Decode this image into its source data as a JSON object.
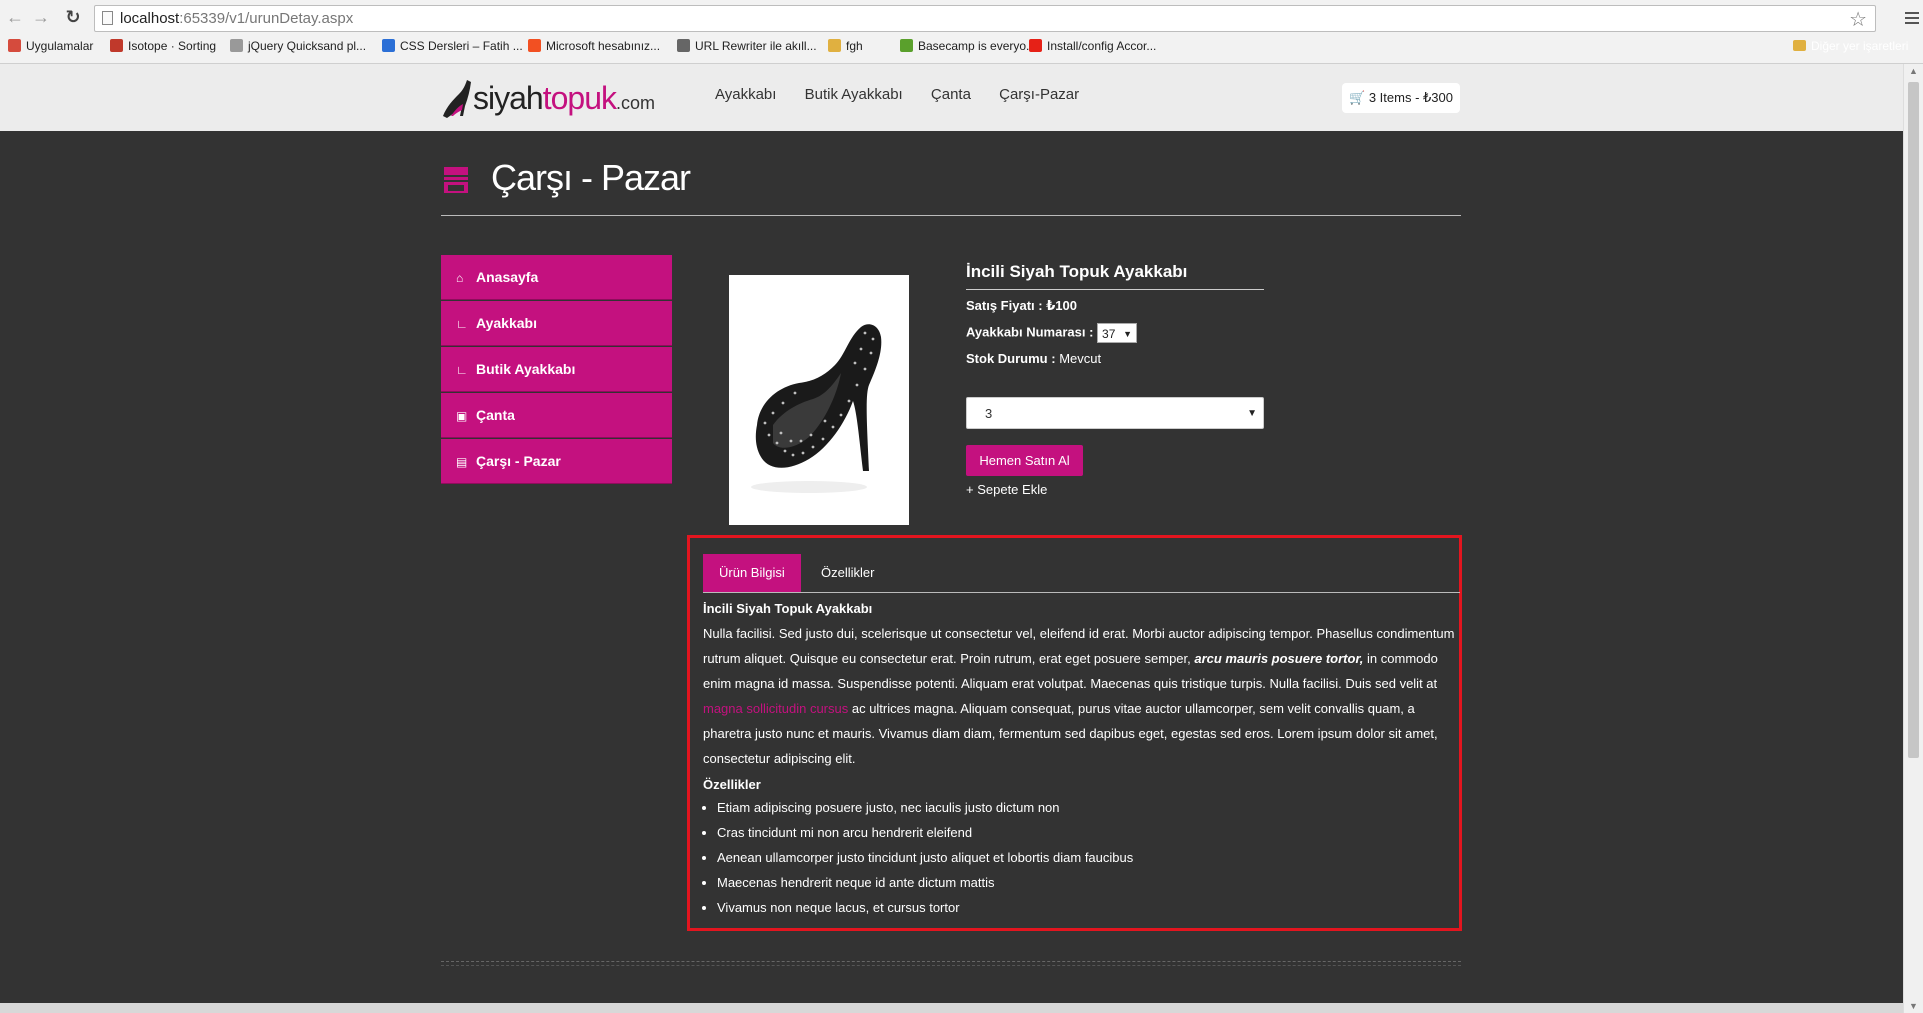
{
  "browser": {
    "url_host": "localhost",
    "url_rest": ":65339/v1/urunDetay.aspx",
    "bookmarks": [
      {
        "label": "Uygulamalar",
        "icon": "apps-grid-icon",
        "color": "#d54b3d"
      },
      {
        "label": "Isotope · Sorting",
        "icon": "isotope-icon",
        "color": "#c0392b"
      },
      {
        "label": "jQuery Quicksand pl...",
        "icon": "page-icon",
        "color": "#999999"
      },
      {
        "label": "CSS Dersleri – Fatih ...",
        "icon": "css-icon",
        "color": "#2b6fd6"
      },
      {
        "label": "Microsoft hesabınız...",
        "icon": "microsoft-icon",
        "color": "#f25022"
      },
      {
        "label": "URL Rewriter ile akıll...",
        "icon": "rewriter-icon",
        "color": "#666666"
      },
      {
        "label": "fgh",
        "icon": "folder-icon",
        "color": "#e0b040"
      },
      {
        "label": "Basecamp is everyo...",
        "icon": "basecamp-icon",
        "color": "#5aa02c"
      },
      {
        "label": "Install/config Accor...",
        "icon": "youtube-icon",
        "color": "#e62117"
      }
    ],
    "other_bookmarks": "Diğer yer işaretleri"
  },
  "header": {
    "logo_main": "siyah",
    "logo_accent": "topuk",
    "logo_suffix": ".com",
    "nav": [
      "Ayakkabı",
      "Butik Ayakkabı",
      "Çanta",
      "Çarşı-Pazar"
    ],
    "cart_label": "3 Items - ₺300"
  },
  "page": {
    "title": "Çarşı - Pazar"
  },
  "sidebar": {
    "items": [
      {
        "label": "Anasayfa",
        "icon": "home-icon"
      },
      {
        "label": "Ayakkabı",
        "icon": "shoe-icon"
      },
      {
        "label": "Butik Ayakkabı",
        "icon": "shoe-icon"
      },
      {
        "label": "Çanta",
        "icon": "bag-icon"
      },
      {
        "label": "Çarşı - Pazar",
        "icon": "market-icon"
      }
    ]
  },
  "product": {
    "name": "İncili Siyah Topuk Ayakkabı",
    "price_label": "Satış Fiyatı :",
    "price_value": "₺100",
    "size_label": "Ayakkabı Numarası :",
    "size_value": "37",
    "stock_label": "Stok Durumu :",
    "stock_value": "Mevcut",
    "quantity": "3",
    "buy_label": "Hemen Satın Al",
    "add_to_cart_label": "+ Sepete Ekle"
  },
  "tabs": {
    "items": [
      "Ürün Bilgisi",
      "Özellikler"
    ],
    "active_index": 0,
    "heading": "İncili Siyah Topuk Ayakkabı",
    "para_1": "Nulla facilisi. Sed justo dui, scelerisque ut consectetur vel, eleifend id erat. Morbi auctor adipiscing tempor. Phasellus condimentum rutrum aliquet. Quisque eu consectetur erat. Proin rutrum, erat eget posuere semper, ",
    "para_em": "arcu mauris posuere tortor,",
    "para_2": " in commodo enim magna id massa. Suspendisse potenti. Aliquam erat volutpat. Maecenas quis tristique turpis. Nulla facilisi. Duis sed velit at ",
    "para_link": "magna sollicitudin cursus",
    "para_3": " ac ultrices magna. Aliquam consequat, purus vitae auctor ullamcorper, sem velit convallis quam, a pharetra justo nunc et mauris. Vivamus diam diam, fermentum sed dapibus eget, egestas sed eros. Lorem ipsum dolor sit amet, consectetur adipiscing elit.",
    "features_heading": "Özellikler",
    "features": [
      "Etiam adipiscing posuere justo, nec iaculis justo dictum non",
      "Cras tincidunt mi non arcu hendrerit eleifend",
      "Aenean ullamcorper justo tincidunt justo aliquet et lobortis diam faucibus",
      "Maecenas hendrerit neque id ante dictum mattis",
      "Vivamus non neque lacus, et cursus tortor"
    ]
  },
  "colors": {
    "brand": "#c4117f",
    "background": "#333333",
    "highlight": "#e3151f"
  }
}
